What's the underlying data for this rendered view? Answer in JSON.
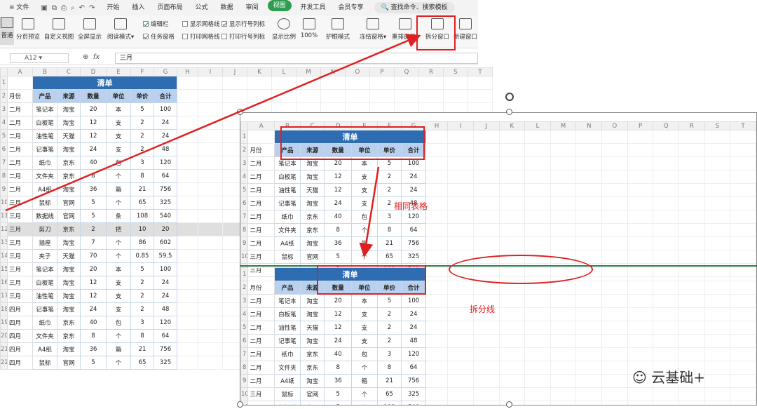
{
  "menu": {
    "file": "文件",
    "tabs": [
      "开始",
      "插入",
      "页面布局",
      "公式",
      "数据",
      "审阅",
      "视图",
      "开发工具",
      "会员专享"
    ],
    "active_tab": "视图",
    "search": "查找命令、搜索模板"
  },
  "ribbon": {
    "buttons": [
      "普通",
      "分页预览",
      "自定义视图",
      "全屏显示",
      "阅读模式",
      "显示比例",
      "100%",
      "护眼模式",
      "冻结窗格",
      "重排窗口",
      "拆分窗口",
      "新建窗口"
    ],
    "checks": [
      {
        "label": "编辑栏",
        "on": true
      },
      {
        "label": "显示网格线",
        "on": false
      },
      {
        "label": "显示行号列标",
        "on": true
      },
      {
        "label": "任务窗格",
        "on": true
      },
      {
        "label": "打印网格线",
        "on": false
      },
      {
        "label": "打印行号列标",
        "on": false
      }
    ]
  },
  "formula_bar": {
    "cell_ref": "A12",
    "fx": "fx",
    "value": "三月"
  },
  "columns": [
    "A",
    "B",
    "C",
    "D",
    "E",
    "F",
    "G",
    "H",
    "I",
    "J",
    "K",
    "L",
    "M",
    "N",
    "O",
    "P",
    "Q",
    "R",
    "S",
    "T"
  ],
  "sheet": {
    "title": "清单",
    "month_header": "月份",
    "headers": [
      "产品",
      "来源",
      "数量",
      "单位",
      "单价",
      "合计"
    ],
    "rows": [
      [
        "二月",
        "笔记本",
        "淘宝",
        "20",
        "本",
        "5",
        "100"
      ],
      [
        "二月",
        "白板笔",
        "淘宝",
        "12",
        "支",
        "2",
        "24"
      ],
      [
        "二月",
        "油性笔",
        "天猫",
        "12",
        "支",
        "2",
        "24"
      ],
      [
        "二月",
        "记事笔",
        "淘宝",
        "24",
        "支",
        "2",
        "48"
      ],
      [
        "二月",
        "纸巾",
        "京东",
        "40",
        "包",
        "3",
        "120"
      ],
      [
        "二月",
        "文件夹",
        "京东",
        "8",
        "个",
        "8",
        "64"
      ],
      [
        "二月",
        "A4纸",
        "淘宝",
        "36",
        "箱",
        "21",
        "756"
      ],
      [
        "三月",
        "鼠标",
        "官网",
        "5",
        "个",
        "65",
        "325"
      ],
      [
        "三月",
        "数据线",
        "官网",
        "5",
        "条",
        "108",
        "540"
      ],
      [
        "三月",
        "剪刀",
        "京东",
        "2",
        "把",
        "10",
        "20"
      ],
      [
        "三月",
        "插座",
        "淘宝",
        "7",
        "个",
        "86",
        "602"
      ],
      [
        "三月",
        "夹子",
        "天猫",
        "70",
        "个",
        "0.85",
        "59.5"
      ],
      [
        "三月",
        "笔记本",
        "淘宝",
        "20",
        "本",
        "5",
        "100"
      ],
      [
        "三月",
        "白板笔",
        "淘宝",
        "12",
        "支",
        "2",
        "24"
      ],
      [
        "三月",
        "油性笔",
        "淘宝",
        "12",
        "支",
        "2",
        "24"
      ],
      [
        "四月",
        "记事笔",
        "淘宝",
        "24",
        "支",
        "2",
        "48"
      ],
      [
        "四月",
        "纸巾",
        "京东",
        "40",
        "包",
        "3",
        "120"
      ],
      [
        "四月",
        "文件夹",
        "京东",
        "8",
        "个",
        "8",
        "64"
      ],
      [
        "四月",
        "A4纸",
        "淘宝",
        "36",
        "箱",
        "21",
        "756"
      ],
      [
        "四月",
        "鼠标",
        "官网",
        "5",
        "个",
        "65",
        "325"
      ]
    ],
    "row_numbers": [
      "1",
      "2",
      "3",
      "4",
      "5",
      "6",
      "7",
      "8",
      "9",
      "10",
      "11",
      "12",
      "13",
      "14",
      "15",
      "16",
      "17",
      "18",
      "19",
      "20",
      "21",
      "22"
    ]
  },
  "annotations": {
    "same_table": "相同表格",
    "split_line": "拆分线"
  },
  "watermark": "云基础+",
  "colors": {
    "accent": "#2f9d4f",
    "title": "#2f6db3",
    "header": "#b9d1ee",
    "annot": "#e02020"
  }
}
